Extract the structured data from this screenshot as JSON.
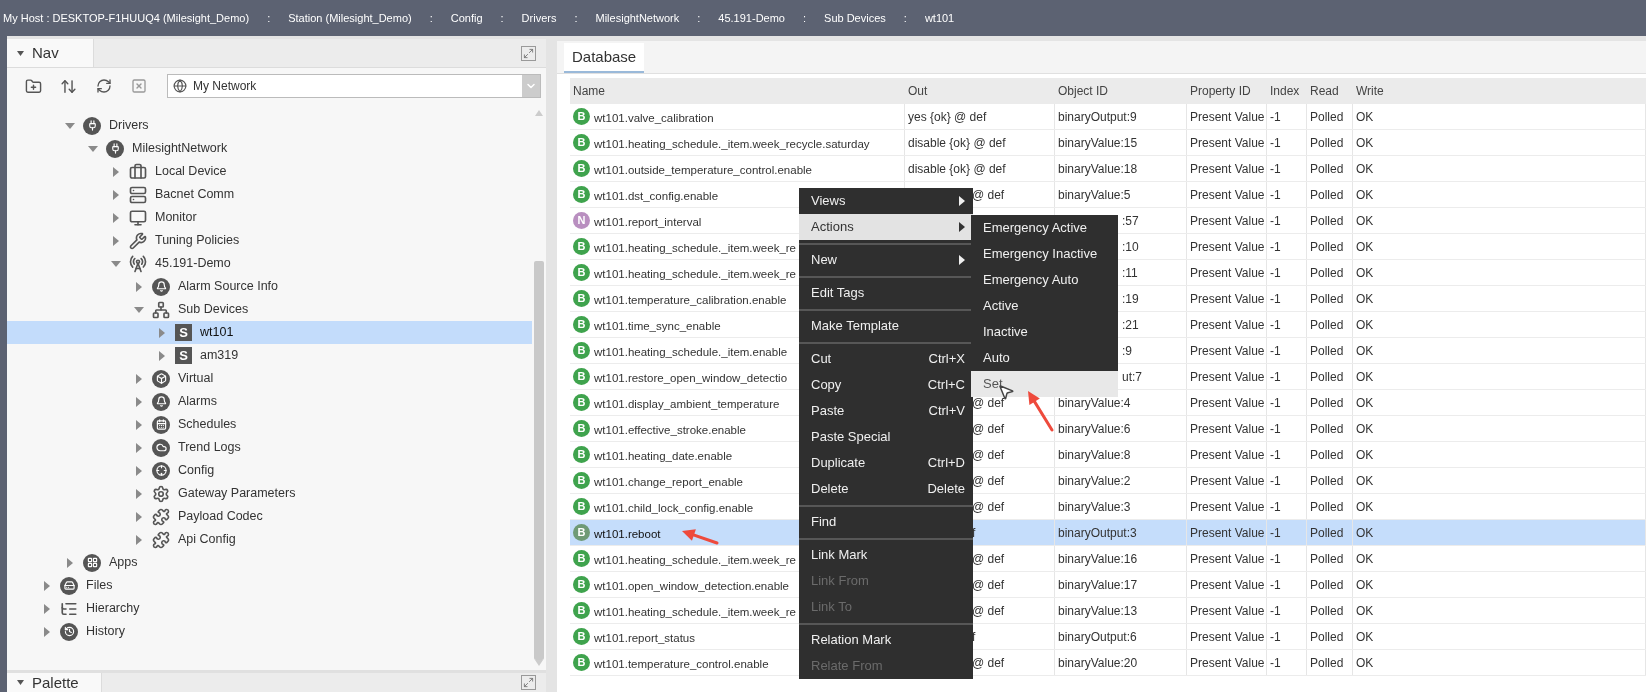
{
  "breadcrumb": {
    "separator": ":",
    "items": [
      "My Host : DESKTOP-F1HUUQ4 (Milesight_Demo)",
      "Station (Milesight_Demo)",
      "Config",
      "Drivers",
      "MilesightNetwork",
      "45.191-Demo",
      "Sub Devices",
      "wt101"
    ]
  },
  "nav": {
    "title": "Nav",
    "network_select": {
      "value": "My Network"
    },
    "tree": [
      {
        "children": [
          {
            "label": "Drivers",
            "kind": "driver",
            "expanded": true,
            "selected": false,
            "children": [
              {
                "label": "MilesightNetwork",
                "kind": "driver",
                "expanded": true,
                "selected": false,
                "children": [
                  {
                    "label": "Local Device",
                    "kind": "device",
                    "expanded": false,
                    "selected": false
                  },
                  {
                    "label": "Bacnet Comm",
                    "kind": "comm",
                    "expanded": false,
                    "selected": false
                  },
                  {
                    "label": "Monitor",
                    "kind": "monitor",
                    "expanded": false,
                    "selected": false
                  },
                  {
                    "label": "Tuning Policies",
                    "kind": "policy",
                    "expanded": false,
                    "selected": false
                  },
                  {
                    "label": "45.191-Demo",
                    "kind": "station",
                    "expanded": true,
                    "selected": false,
                    "children": [
                      {
                        "label": "Alarm Source Info",
                        "kind": "alarm",
                        "expanded": false,
                        "selected": false
                      },
                      {
                        "label": "Sub Devices",
                        "kind": "subdevices",
                        "expanded": true,
                        "selected": false,
                        "children": [
                          {
                            "label": "wt101",
                            "kind": "point-device",
                            "badge": "S",
                            "expanded": false,
                            "selected": true
                          },
                          {
                            "label": "am319",
                            "kind": "point-device",
                            "badge": "S",
                            "expanded": false,
                            "selected": false
                          }
                        ]
                      },
                      {
                        "label": "Virtual",
                        "kind": "virtual",
                        "expanded": false,
                        "selected": false
                      },
                      {
                        "label": "Alarms",
                        "kind": "alarm",
                        "expanded": false,
                        "selected": false
                      },
                      {
                        "label": "Schedules",
                        "kind": "schedule",
                        "expanded": false,
                        "selected": false
                      },
                      {
                        "label": "Trend Logs",
                        "kind": "trend",
                        "expanded": false,
                        "selected": false
                      },
                      {
                        "label": "Config",
                        "kind": "config",
                        "expanded": false,
                        "selected": false
                      },
                      {
                        "label": "Gateway Parameters",
                        "kind": "gear",
                        "expanded": false,
                        "selected": false
                      },
                      {
                        "label": "Payload Codec",
                        "kind": "plugin",
                        "expanded": false,
                        "selected": false
                      },
                      {
                        "label": "Api Config",
                        "kind": "plugin",
                        "expanded": false,
                        "selected": false
                      }
                    ]
                  }
                ]
              }
            ]
          },
          {
            "label": "Apps",
            "kind": "apps",
            "expanded": false,
            "selected": false
          }
        ]
      },
      {
        "label": "Files",
        "kind": "files",
        "expanded": false,
        "selected": false
      },
      {
        "label": "Hierarchy",
        "kind": "hierarchy",
        "expanded": false,
        "selected": false
      },
      {
        "label": "History",
        "kind": "history",
        "expanded": false,
        "selected": false
      }
    ]
  },
  "palette": {
    "title": "Palette"
  },
  "database": {
    "tab": "Database",
    "columns": [
      "Name",
      "Out",
      "Object ID",
      "Property ID",
      "Index",
      "Read",
      "Write"
    ],
    "rows": [
      {
        "badge": "B",
        "color": "#3fa34d",
        "name": "wt101.valve_calibration",
        "out": "yes {ok} @ def",
        "out_clipped": false,
        "object_id": "binaryOutput:9",
        "object_id_clipped": false,
        "property_id": "Present Value",
        "index": "-1",
        "read": "Polled",
        "write": "OK",
        "selected": false
      },
      {
        "badge": "B",
        "color": "#3fa34d",
        "name": "wt101.heating_schedule._item.week_recycle.saturday",
        "out": "disable {ok} @ def",
        "out_clipped": false,
        "object_id": "binaryValue:15",
        "object_id_clipped": false,
        "property_id": "Present Value",
        "index": "-1",
        "read": "Polled",
        "write": "OK",
        "selected": false
      },
      {
        "badge": "B",
        "color": "#3fa34d",
        "name": "wt101.outside_temperature_control.enable",
        "out": "disable {ok} @ def",
        "out_clipped": false,
        "object_id": "binaryValue:18",
        "object_id_clipped": false,
        "property_id": "Present Value",
        "index": "-1",
        "read": "Polled",
        "write": "OK",
        "selected": false
      },
      {
        "badge": "B",
        "color": "#3fa34d",
        "name": "wt101.dst_config.enable",
        "out": "@ def",
        "out_clipped": true,
        "object_id": "binaryValue:5",
        "object_id_clipped": false,
        "property_id": "Present Value",
        "index": "-1",
        "read": "Polled",
        "write": "OK",
        "selected": false
      },
      {
        "badge": "N",
        "color": "#b98fc0",
        "name": "wt101.report_interval",
        "object_id": ":57",
        "object_id_clipped": true,
        "property_id": "Present Value",
        "index": "-1",
        "read": "Polled",
        "write": "OK",
        "selected": false
      },
      {
        "badge": "B",
        "color": "#3fa34d",
        "name": "wt101.heating_schedule._item.week_re",
        "object_id": ":10",
        "object_id_clipped": true,
        "property_id": "Present Value",
        "index": "-1",
        "read": "Polled",
        "write": "OK",
        "selected": false
      },
      {
        "badge": "B",
        "color": "#3fa34d",
        "name": "wt101.heating_schedule._item.week_re",
        "object_id": ":11",
        "object_id_clipped": true,
        "property_id": "Present Value",
        "index": "-1",
        "read": "Polled",
        "write": "OK",
        "selected": false
      },
      {
        "badge": "B",
        "color": "#3fa34d",
        "name": "wt101.temperature_calibration.enable",
        "object_id": ":19",
        "object_id_clipped": true,
        "property_id": "Present Value",
        "index": "-1",
        "read": "Polled",
        "write": "OK",
        "selected": false
      },
      {
        "badge": "B",
        "color": "#3fa34d",
        "name": "wt101.time_sync_enable",
        "object_id": ":21",
        "object_id_clipped": true,
        "property_id": "Present Value",
        "index": "-1",
        "read": "Polled",
        "write": "OK",
        "selected": false
      },
      {
        "badge": "B",
        "color": "#3fa34d",
        "name": "wt101.heating_schedule._item.enable",
        "object_id": ":9",
        "object_id_clipped": true,
        "property_id": "Present Value",
        "index": "-1",
        "read": "Polled",
        "write": "OK",
        "selected": false
      },
      {
        "badge": "B",
        "color": "#3fa34d",
        "name": "wt101.restore_open_window_detectio",
        "object_id": "ut:7",
        "object_id_clipped": true,
        "property_id": "Present Value",
        "index": "-1",
        "read": "Polled",
        "write": "OK",
        "selected": false
      },
      {
        "badge": "B",
        "color": "#3fa34d",
        "name": "wt101.display_ambient_temperature",
        "out": "@ def",
        "out_clipped": true,
        "object_id": "binaryValue:4",
        "object_id_clipped": false,
        "property_id": "Present Value",
        "index": "-1",
        "read": "Polled",
        "write": "OK",
        "selected": false
      },
      {
        "badge": "B",
        "color": "#3fa34d",
        "name": "wt101.effective_stroke.enable",
        "out": "@ def",
        "out_clipped": true,
        "object_id": "binaryValue:6",
        "object_id_clipped": false,
        "property_id": "Present Value",
        "index": "-1",
        "read": "Polled",
        "write": "OK",
        "selected": false
      },
      {
        "badge": "B",
        "color": "#3fa34d",
        "name": "wt101.heating_date.enable",
        "out": "@ def",
        "out_clipped": true,
        "object_id": "binaryValue:8",
        "object_id_clipped": false,
        "property_id": "Present Value",
        "index": "-1",
        "read": "Polled",
        "write": "OK",
        "selected": false
      },
      {
        "badge": "B",
        "color": "#3fa34d",
        "name": "wt101.change_report_enable",
        "out": "@ def",
        "out_clipped": true,
        "object_id": "binaryValue:2",
        "object_id_clipped": false,
        "property_id": "Present Value",
        "index": "-1",
        "read": "Polled",
        "write": "OK",
        "selected": false
      },
      {
        "badge": "B",
        "color": "#3fa34d",
        "name": "wt101.child_lock_config.enable",
        "out": "@ def",
        "out_clipped": true,
        "object_id": "binaryValue:3",
        "object_id_clipped": false,
        "property_id": "Present Value",
        "index": "-1",
        "read": "Polled",
        "write": "OK",
        "selected": false
      },
      {
        "badge": "B",
        "color": "#6f9a76",
        "name": "wt101.reboot",
        "out": "f",
        "out_clipped": true,
        "object_id": "binaryOutput:3",
        "object_id_clipped": false,
        "property_id": "Present Value",
        "index": "-1",
        "read": "Polled",
        "write": "OK",
        "selected": true
      },
      {
        "badge": "B",
        "color": "#3fa34d",
        "name": "wt101.heating_schedule._item.week_re",
        "out": "@ def",
        "out_clipped": true,
        "object_id": "binaryValue:16",
        "object_id_clipped": false,
        "property_id": "Present Value",
        "index": "-1",
        "read": "Polled",
        "write": "OK",
        "selected": false
      },
      {
        "badge": "B",
        "color": "#3fa34d",
        "name": "wt101.open_window_detection.enable",
        "out": "@ def",
        "out_clipped": true,
        "object_id": "binaryValue:17",
        "object_id_clipped": false,
        "property_id": "Present Value",
        "index": "-1",
        "read": "Polled",
        "write": "OK",
        "selected": false
      },
      {
        "badge": "B",
        "color": "#3fa34d",
        "name": "wt101.heating_schedule._item.week_re",
        "out": "@ def",
        "out_clipped": true,
        "object_id": "binaryValue:13",
        "object_id_clipped": false,
        "property_id": "Present Value",
        "index": "-1",
        "read": "Polled",
        "write": "OK",
        "selected": false
      },
      {
        "badge": "B",
        "color": "#3fa34d",
        "name": "wt101.report_status",
        "out": "f",
        "out_clipped": true,
        "object_id": "binaryOutput:6",
        "object_id_clipped": false,
        "property_id": "Present Value",
        "index": "-1",
        "read": "Polled",
        "write": "OK",
        "selected": false
      },
      {
        "badge": "B",
        "color": "#3fa34d",
        "name": "wt101.temperature_control.enable",
        "out": "@ def",
        "out_clipped": true,
        "object_id": "binaryValue:20",
        "object_id_clipped": false,
        "property_id": "Present Value",
        "index": "-1",
        "read": "Polled",
        "write": "OK",
        "selected": false
      }
    ]
  },
  "context_menu": {
    "items": [
      {
        "kind": "item",
        "label": "Views",
        "has_submenu": true,
        "selected": false,
        "disabled": false
      },
      {
        "kind": "item",
        "label": "Actions",
        "has_submenu": true,
        "selected": true,
        "disabled": false
      },
      {
        "kind": "separator"
      },
      {
        "kind": "item",
        "label": "New",
        "has_submenu": true,
        "selected": false,
        "disabled": false
      },
      {
        "kind": "separator"
      },
      {
        "kind": "item",
        "label": "Edit Tags",
        "has_submenu": false,
        "selected": false,
        "disabled": false
      },
      {
        "kind": "separator"
      },
      {
        "kind": "item",
        "label": "Make Template",
        "has_submenu": false,
        "selected": false,
        "disabled": false
      },
      {
        "kind": "separator"
      },
      {
        "kind": "item",
        "label": "Cut",
        "shortcut": "Ctrl+X",
        "has_submenu": false,
        "selected": false,
        "disabled": false
      },
      {
        "kind": "item",
        "label": "Copy",
        "shortcut": "Ctrl+C",
        "has_submenu": false,
        "selected": false,
        "disabled": false
      },
      {
        "kind": "item",
        "label": "Paste",
        "shortcut": "Ctrl+V",
        "has_submenu": false,
        "selected": false,
        "disabled": false
      },
      {
        "kind": "item",
        "label": "Paste Special",
        "has_submenu": false,
        "selected": false,
        "disabled": false
      },
      {
        "kind": "item",
        "label": "Duplicate",
        "shortcut": "Ctrl+D",
        "has_submenu": false,
        "selected": false,
        "disabled": false
      },
      {
        "kind": "item",
        "label": "Delete",
        "shortcut": "Delete",
        "has_submenu": false,
        "selected": false,
        "disabled": false
      },
      {
        "kind": "separator"
      },
      {
        "kind": "item",
        "label": "Find",
        "has_submenu": false,
        "selected": false,
        "disabled": false
      },
      {
        "kind": "separator"
      },
      {
        "kind": "item",
        "label": "Link Mark",
        "has_submenu": false,
        "selected": false,
        "disabled": false
      },
      {
        "kind": "item",
        "label": "Link From",
        "has_submenu": false,
        "selected": false,
        "disabled": true
      },
      {
        "kind": "item",
        "label": "Link To",
        "has_submenu": false,
        "selected": false,
        "disabled": true
      },
      {
        "kind": "separator"
      },
      {
        "kind": "item",
        "label": "Relation Mark",
        "has_submenu": false,
        "selected": false,
        "disabled": false
      },
      {
        "kind": "item",
        "label": "Relate From",
        "has_submenu": false,
        "selected": false,
        "disabled": true
      }
    ],
    "submenu": {
      "items": [
        {
          "label": "Emergency Active",
          "selected": false
        },
        {
          "label": "Emergency Inactive",
          "selected": false
        },
        {
          "label": "Emergency Auto",
          "selected": false
        },
        {
          "label": "Active",
          "selected": false
        },
        {
          "label": "Inactive",
          "selected": false
        },
        {
          "label": "Auto",
          "selected": false
        },
        {
          "label": "Set",
          "selected": true
        }
      ]
    }
  }
}
